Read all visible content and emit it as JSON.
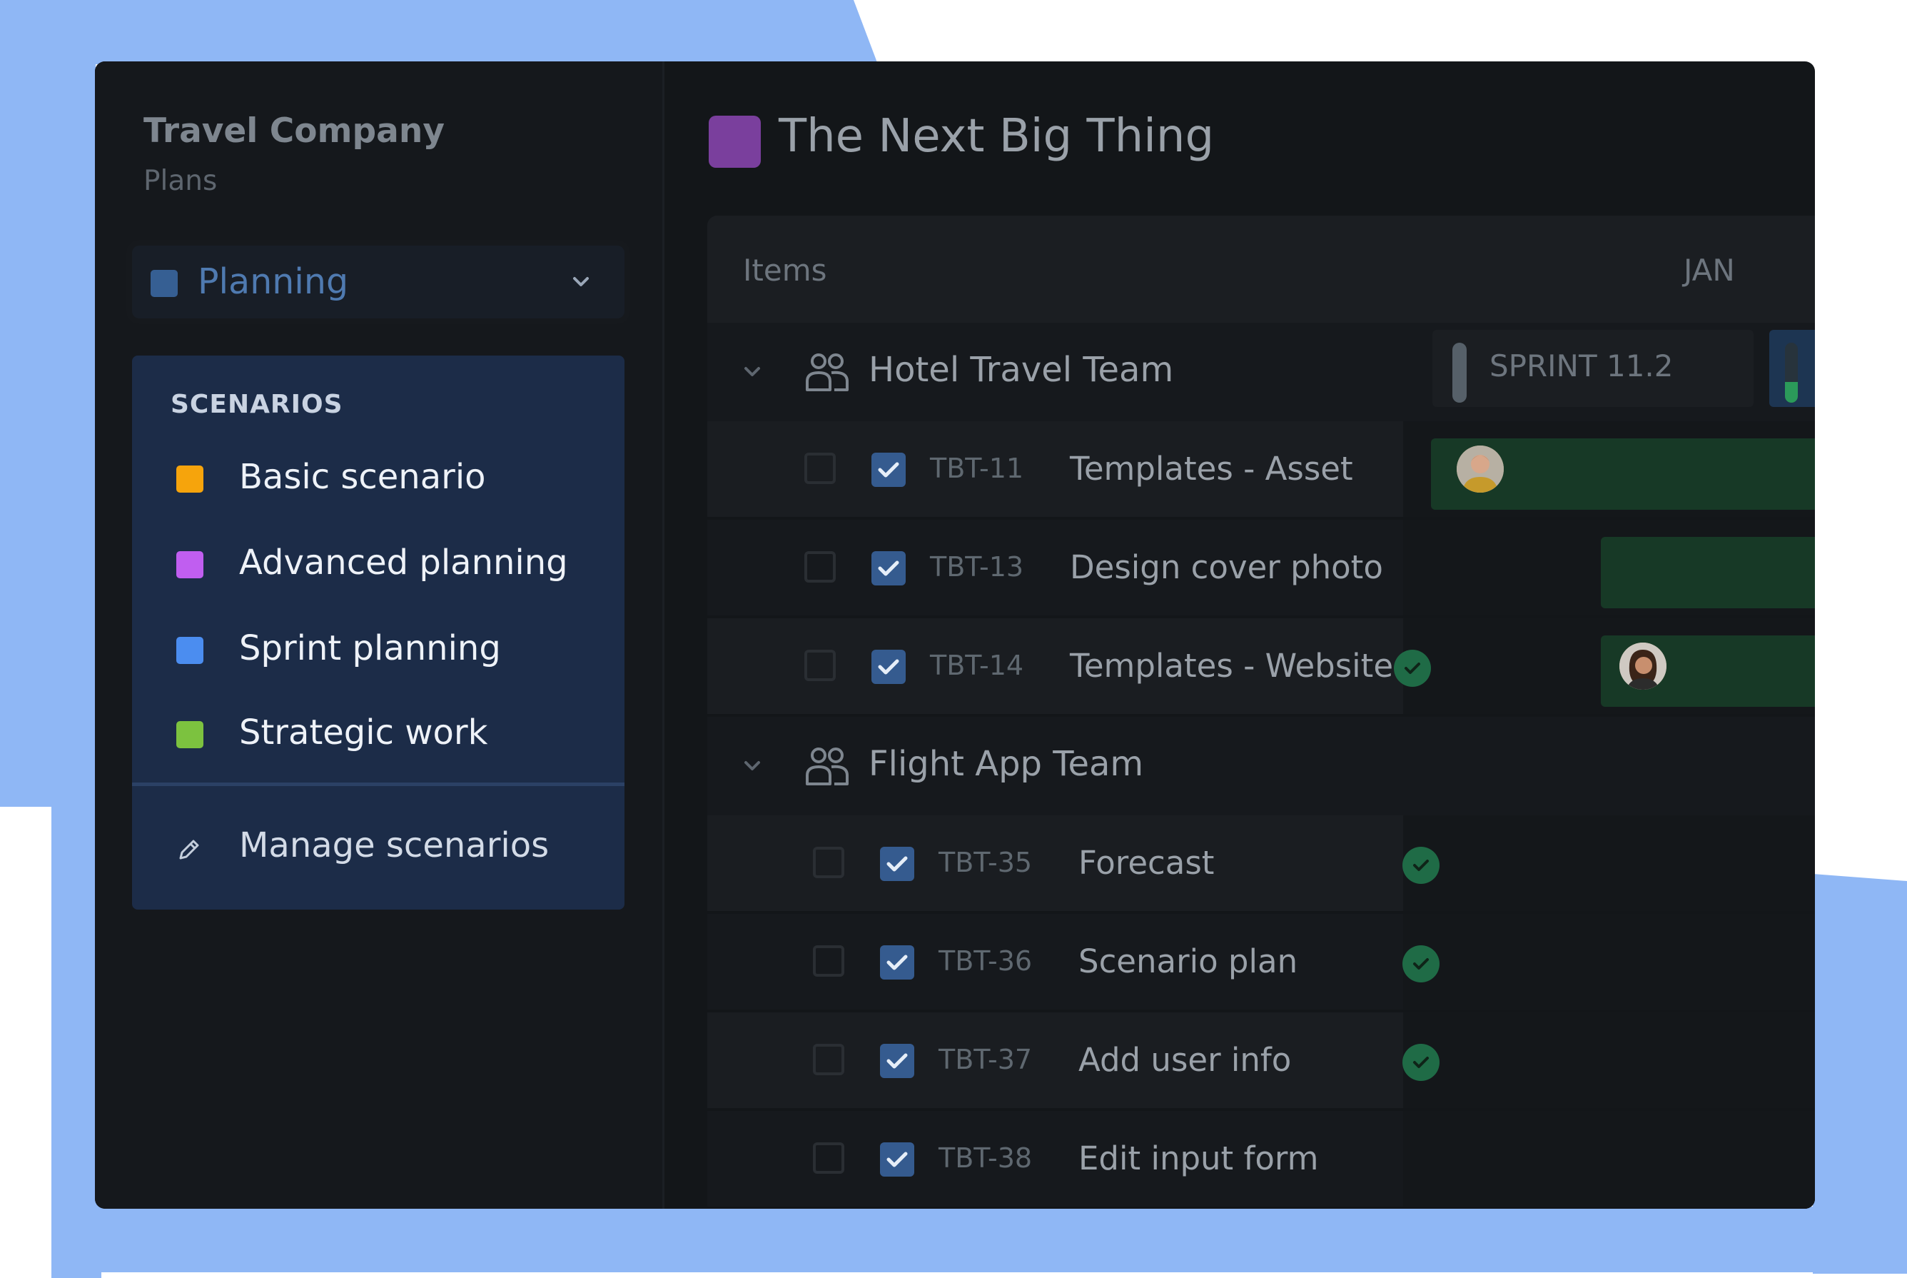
{
  "colors": {
    "background_blue": "#8fb7f5",
    "window": "#131619",
    "title_swatch": "#7a3f9d",
    "plan_swatch": "#365f93",
    "done": "#1f6b46",
    "bar": "#173926"
  },
  "sidebar": {
    "org_name": "Travel Company",
    "org_sub": "Plans",
    "plan_select": {
      "label": "Planning",
      "icon": "chevron-down-icon"
    },
    "scenarios": {
      "heading": "SCENARIOS",
      "items": [
        {
          "label": "Basic scenario",
          "color": "#f6a40c"
        },
        {
          "label": "Advanced planning",
          "color": "#c05ef0"
        },
        {
          "label": "Sprint planning",
          "color": "#4b8df0"
        },
        {
          "label": "Strategic work",
          "color": "#7cc23f"
        }
      ],
      "manage": {
        "label": "Manage scenarios",
        "icon": "pencil-icon"
      }
    }
  },
  "main": {
    "title": "The Next Big Thing",
    "columns": {
      "items": "Items",
      "month": "JAN"
    },
    "sprint": {
      "label": "SPRINT 11.2",
      "next_progress": 0.35
    },
    "teams": [
      {
        "name": "Hotel Travel Team",
        "icon": "team-icon",
        "items": [
          {
            "key": "TBT-11",
            "summary": "Templates - Asset",
            "done": false
          },
          {
            "key": "TBT-13",
            "summary": "Design cover photo",
            "done": false
          },
          {
            "key": "TBT-14",
            "summary": "Templates - Website",
            "done": true
          }
        ]
      },
      {
        "name": "Flight App Team",
        "icon": "team-icon",
        "items": [
          {
            "key": "TBT-35",
            "summary": "Forecast",
            "done": true
          },
          {
            "key": "TBT-36",
            "summary": "Scenario plan",
            "done": true
          },
          {
            "key": "TBT-37",
            "summary": "Add user info",
            "done": true
          },
          {
            "key": "TBT-38",
            "summary": "Edit input form",
            "done": false
          }
        ]
      }
    ]
  }
}
